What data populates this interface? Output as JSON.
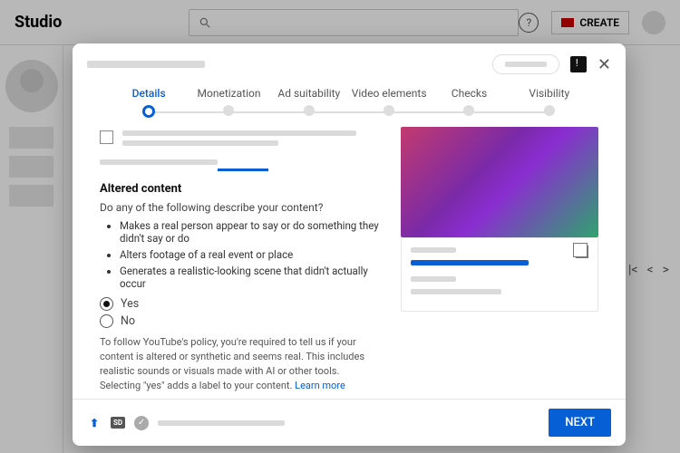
{
  "topbar": {
    "logo": "Studio",
    "create": "CREATE"
  },
  "stepper": [
    "Details",
    "Monetization",
    "Ad suitability",
    "Video elements",
    "Checks",
    "Visibility"
  ],
  "altered": {
    "heading": "Altered content",
    "question": "Do any of the following describe your content?",
    "bullets": [
      "Makes a real person appear to say or do something they didn't say or do",
      "Alters footage of a real event or place",
      "Generates a realistic-looking scene that didn't actually occur"
    ],
    "yes": "Yes",
    "no": "No",
    "policy": "To follow YouTube's policy, you're required to tell us if your content is altered or synthetic and seems real. This includes realistic sounds or visuals made with AI or other tools. Selecting \"yes\" adds a label to your content. ",
    "learn": "Learn more"
  },
  "footer": {
    "next": "NEXT",
    "sd": "SD"
  },
  "pager": {
    "prevAll": "|<",
    "prev": "<",
    "next": ">"
  }
}
